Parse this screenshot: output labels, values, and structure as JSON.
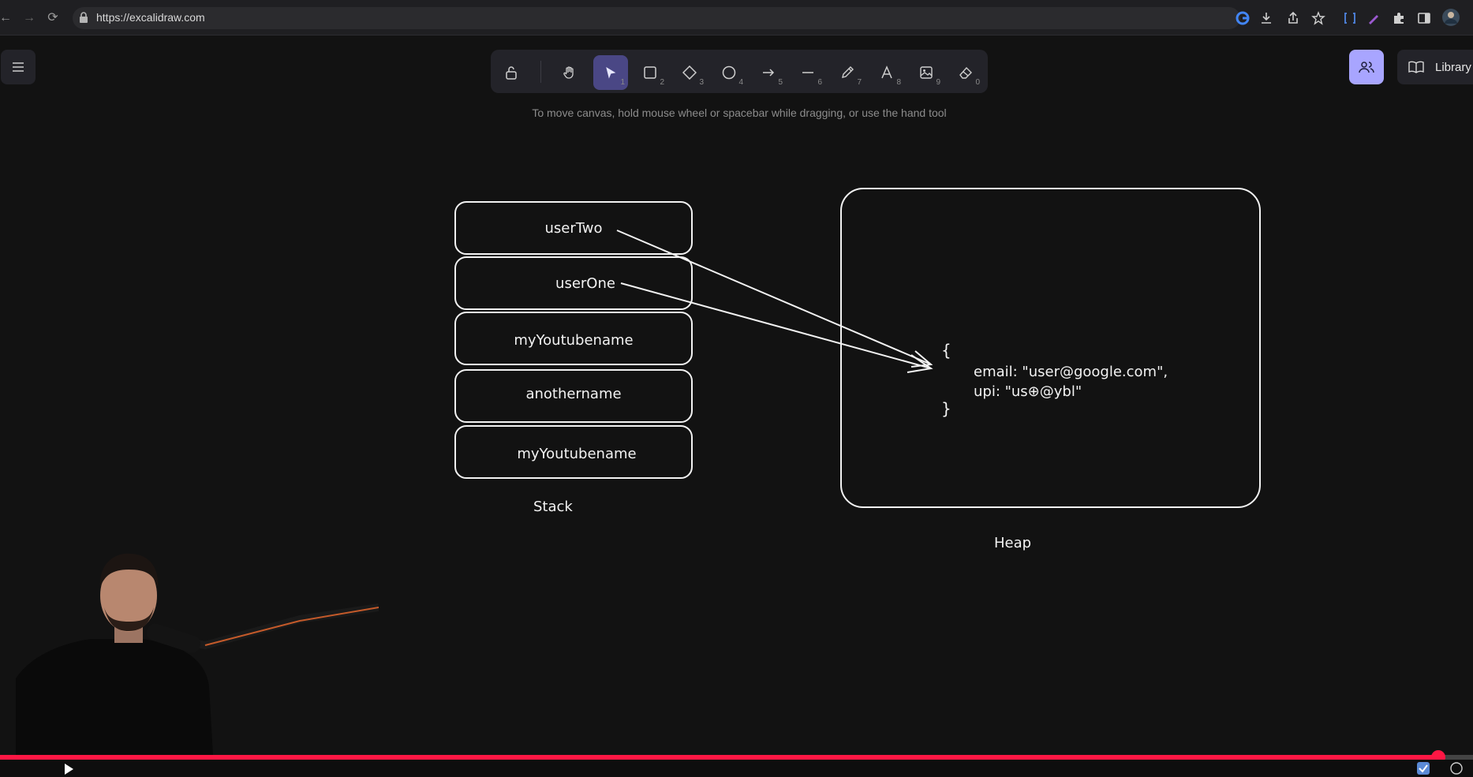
{
  "browser": {
    "url": "https://excalidraw.com"
  },
  "toolbar": {
    "tools": [
      {
        "name": "lock",
        "num": ""
      },
      {
        "name": "hand",
        "num": ""
      },
      {
        "name": "selection",
        "num": "1",
        "active": true
      },
      {
        "name": "rectangle",
        "num": "2"
      },
      {
        "name": "diamond",
        "num": "3"
      },
      {
        "name": "ellipse",
        "num": "4"
      },
      {
        "name": "arrow",
        "num": "5"
      },
      {
        "name": "line",
        "num": "6"
      },
      {
        "name": "draw",
        "num": "7"
      },
      {
        "name": "text",
        "num": "8"
      },
      {
        "name": "image",
        "num": "9"
      },
      {
        "name": "eraser",
        "num": "0"
      }
    ],
    "hint": "To move canvas, hold mouse wheel or spacebar while dragging, or use the hand tool"
  },
  "library": {
    "label": "Library"
  },
  "canvas": {
    "stack_items": [
      "userTwo",
      "userOne",
      "myYoutubename",
      "anothername",
      "myYoutubename"
    ],
    "stack_label": "Stack",
    "heap_label": "Heap",
    "heap_object": {
      "open": "{",
      "email_line": "email: \"user@google.com\",",
      "upi_line": "upi: \"us⊕@ybl\"",
      "close": "}"
    }
  },
  "colors": {
    "accent": "#a8a5ff",
    "active_tool": "#4a4785",
    "progress": "#ff1744"
  },
  "video": {
    "progress": 0.977
  }
}
